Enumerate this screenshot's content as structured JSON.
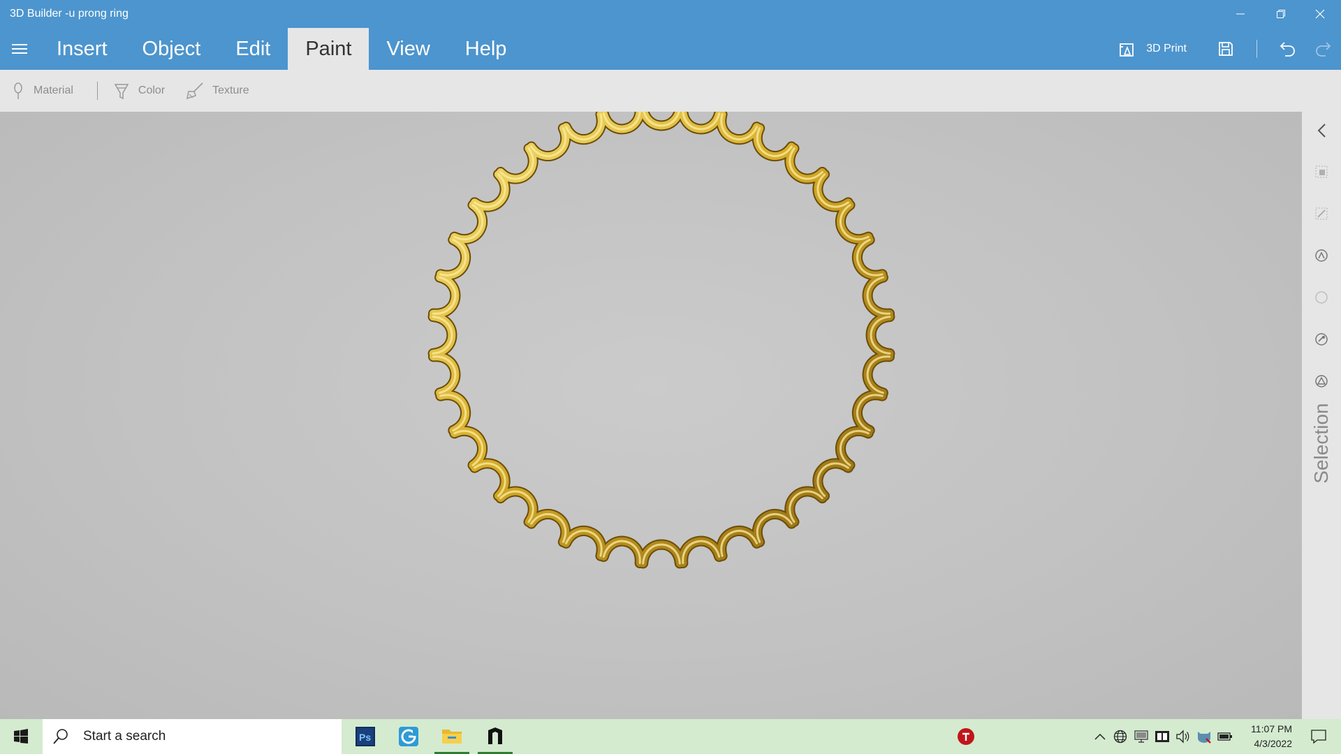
{
  "window": {
    "title": "3D Builder -u prong ring"
  },
  "menu": {
    "tabs": [
      "Insert",
      "Object",
      "Edit",
      "Paint",
      "View",
      "Help"
    ],
    "active_tab": "Paint",
    "print_label": "3D Print"
  },
  "ribbon": {
    "material_label": "Material",
    "color_label": "Color",
    "texture_label": "Texture"
  },
  "side_panel": {
    "label": "Selection"
  },
  "model": {
    "color": "#c9a021",
    "prongs": 36
  },
  "taskbar": {
    "search_placeholder": "Start a search",
    "time": "11:07 PM",
    "date": "4/3/2022",
    "apps": [
      "Photoshop",
      "Google Chrome",
      "File Explorer",
      "3D Builder"
    ]
  },
  "colors": {
    "titlebar": "#4d95ce",
    "ribbon": "#e6e6e6",
    "viewport": "#c4c4c4",
    "taskbar": "#d4ebd0"
  }
}
